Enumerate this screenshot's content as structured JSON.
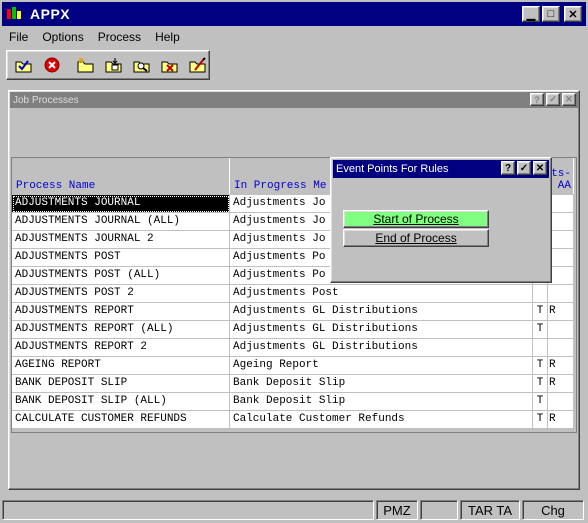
{
  "app": {
    "title": "APPX"
  },
  "menu": [
    "File",
    "Options",
    "Process",
    "Help"
  ],
  "toolbar": [
    "check-folder-icon",
    "cancel-icon",
    "new-folder-icon",
    "open-folder-icon",
    "search-folder-icon",
    "delete-folder-icon",
    "edit-folder-icon"
  ],
  "job_window": {
    "title": "Job Processes",
    "headers": {
      "process_name": "Process Name",
      "in_progress": "In Progress Me",
      "extra_top": "ts-",
      "extra_bottom": "AA"
    },
    "rows": [
      {
        "name": "ADJUSTMENTS JOURNAL",
        "in_progress": "Adjustments Jo",
        "flag": "",
        "extra": "",
        "selected": true
      },
      {
        "name": "ADJUSTMENTS JOURNAL (ALL)",
        "in_progress": "Adjustments Jo",
        "flag": "",
        "extra": ""
      },
      {
        "name": "ADJUSTMENTS JOURNAL 2",
        "in_progress": "Adjustments Jo",
        "flag": "",
        "extra": ""
      },
      {
        "name": "ADJUSTMENTS POST",
        "in_progress": "Adjustments Po",
        "flag": "",
        "extra": ""
      },
      {
        "name": "ADJUSTMENTS POST (ALL)",
        "in_progress": "Adjustments Po",
        "flag": "",
        "extra": ""
      },
      {
        "name": "ADJUSTMENTS POST 2",
        "in_progress": "Adjustments Post",
        "flag": "",
        "extra": ""
      },
      {
        "name": "ADJUSTMENTS REPORT",
        "in_progress": "Adjustments GL Distributions",
        "flag": "T",
        "extra": "R"
      },
      {
        "name": "ADJUSTMENTS REPORT (ALL)",
        "in_progress": "Adjustments GL Distributions",
        "flag": "T",
        "extra": ""
      },
      {
        "name": "ADJUSTMENTS REPORT 2",
        "in_progress": "Adjustments GL Distributions",
        "flag": "",
        "extra": ""
      },
      {
        "name": "AGEING REPORT",
        "in_progress": "Ageing Report",
        "flag": "T",
        "extra": "R"
      },
      {
        "name": "BANK DEPOSIT SLIP",
        "in_progress": "Bank Deposit Slip",
        "flag": "T",
        "extra": "R"
      },
      {
        "name": "BANK DEPOSIT SLIP (ALL)",
        "in_progress": "Bank Deposit Slip",
        "flag": "T",
        "extra": ""
      },
      {
        "name": "CALCULATE CUSTOMER REFUNDS",
        "in_progress": "Calculate Customer Refunds",
        "flag": "T",
        "extra": "R"
      }
    ]
  },
  "event_dialog": {
    "title": "Event Points For Rules",
    "start_label": "Start of Process",
    "end_label": "End of Process"
  },
  "statusbar": [
    "",
    "PMZ",
    "",
    "TAR TA",
    "Chg"
  ],
  "colors": {
    "title_active": "#000080",
    "title_inactive": "#808080",
    "start_button": "#80ff80",
    "header_text": "#0000d0"
  }
}
